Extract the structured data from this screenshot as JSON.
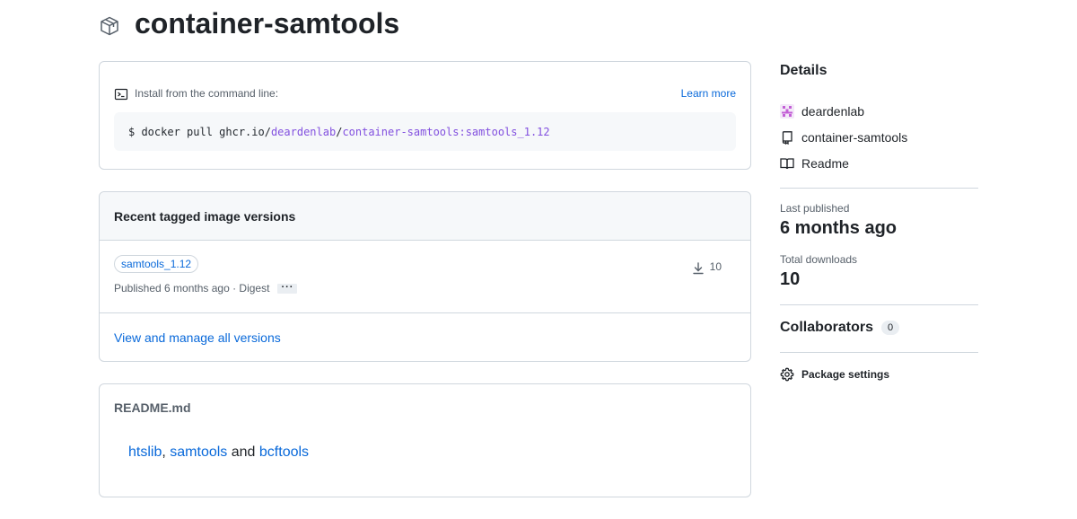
{
  "header": {
    "title": "container-samtools",
    "icon": "package-icon"
  },
  "install": {
    "label": "Install from the command line:",
    "learn_more": "Learn more",
    "cmd_prefix": "$ docker pull ghcr.io/",
    "cmd_owner": "deardenlab",
    "cmd_sep": "/",
    "cmd_image": "container-samtools:samtools_1.12"
  },
  "versions": {
    "title": "Recent tagged image versions",
    "items": [
      {
        "tag": "samtools_1.12",
        "published": "Published 6 months ago · Digest",
        "more": "···",
        "downloads": "10"
      }
    ],
    "view_all": "View and manage all versions"
  },
  "readme": {
    "title": "README.md",
    "links": [
      "htslib",
      "samtools",
      "bcftools"
    ],
    "sep1": ",",
    "sep2": "and"
  },
  "sidebar": {
    "details_title": "Details",
    "owner": "deardenlab",
    "repo": "container-samtools",
    "readme": "Readme",
    "last_published_label": "Last published",
    "last_published_value": "6 months ago",
    "total_downloads_label": "Total downloads",
    "total_downloads_value": "10",
    "collaborators_label": "Collaborators",
    "collaborators_count": "0",
    "settings_label": "Package settings"
  },
  "colors": {
    "link": "#0969da",
    "purple": "#8250df",
    "border": "#d0d7de"
  }
}
